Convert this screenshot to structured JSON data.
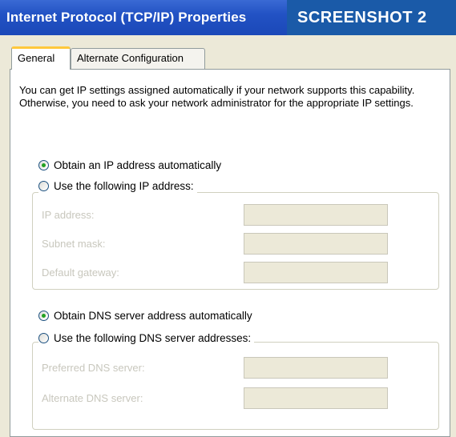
{
  "window": {
    "title": "Internet Protocol (TCP/IP) Properties",
    "overlay_label": "SCREENSHOT 2"
  },
  "tabs": [
    {
      "label": "General",
      "active": true
    },
    {
      "label": "Alternate Configuration",
      "active": false
    }
  ],
  "intro_text": "You can get IP settings assigned automatically if your network supports this capability. Otherwise, you need to ask your network administrator for the appropriate IP settings.",
  "ip": {
    "auto_label": "Obtain an IP address automatically",
    "auto_selected": true,
    "manual_label": "Use the following IP address:",
    "manual_selected": false,
    "fields": [
      {
        "label": "IP address:",
        "value": ""
      },
      {
        "label": "Subnet mask:",
        "value": ""
      },
      {
        "label": "Default gateway:",
        "value": ""
      }
    ]
  },
  "dns": {
    "auto_label": "Obtain DNS server address automatically",
    "auto_selected": true,
    "manual_label": "Use the following DNS server addresses:",
    "manual_selected": false,
    "fields": [
      {
        "label": "Preferred DNS server:",
        "value": ""
      },
      {
        "label": "Alternate DNS server:",
        "value": ""
      }
    ]
  },
  "colors": {
    "titlebar": "#2252c4",
    "overlay": "#1a5aa8",
    "dialog_bg": "#ece9d8",
    "tab_highlight": "#ffc83c",
    "radio_dot": "#21a121"
  }
}
